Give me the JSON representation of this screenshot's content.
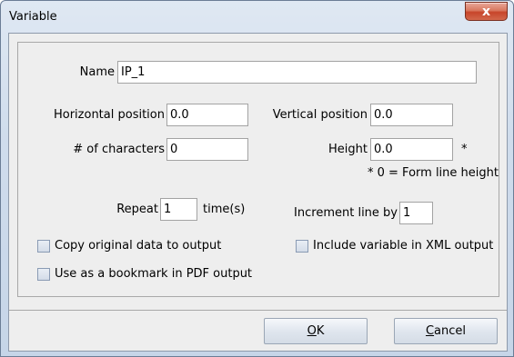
{
  "window": {
    "title": "Variable",
    "close_glyph": "x"
  },
  "form": {
    "name_label": "Name",
    "name_value": "IP_1",
    "hpos_label": "Horizontal position",
    "hpos_value": "0.0",
    "vpos_label": "Vertical position",
    "vpos_value": "0.0",
    "chars_label": "# of characters",
    "chars_value": "0",
    "height_label": "Height",
    "height_value": "0.0",
    "height_asterisk": "*",
    "height_note": "* 0 = Form line height",
    "repeat_label": "Repeat",
    "repeat_value": "1",
    "repeat_unit": "time(s)",
    "increment_label": "Increment line by",
    "increment_value": "1",
    "copy_label": "Copy original data to output",
    "xml_label": "Include variable in XML output",
    "bookmark_label": "Use as a bookmark in PDF output"
  },
  "buttons": {
    "ok_mnemonic": "O",
    "ok_rest": "K",
    "cancel_mnemonic": "C",
    "cancel_rest": "ancel"
  }
}
